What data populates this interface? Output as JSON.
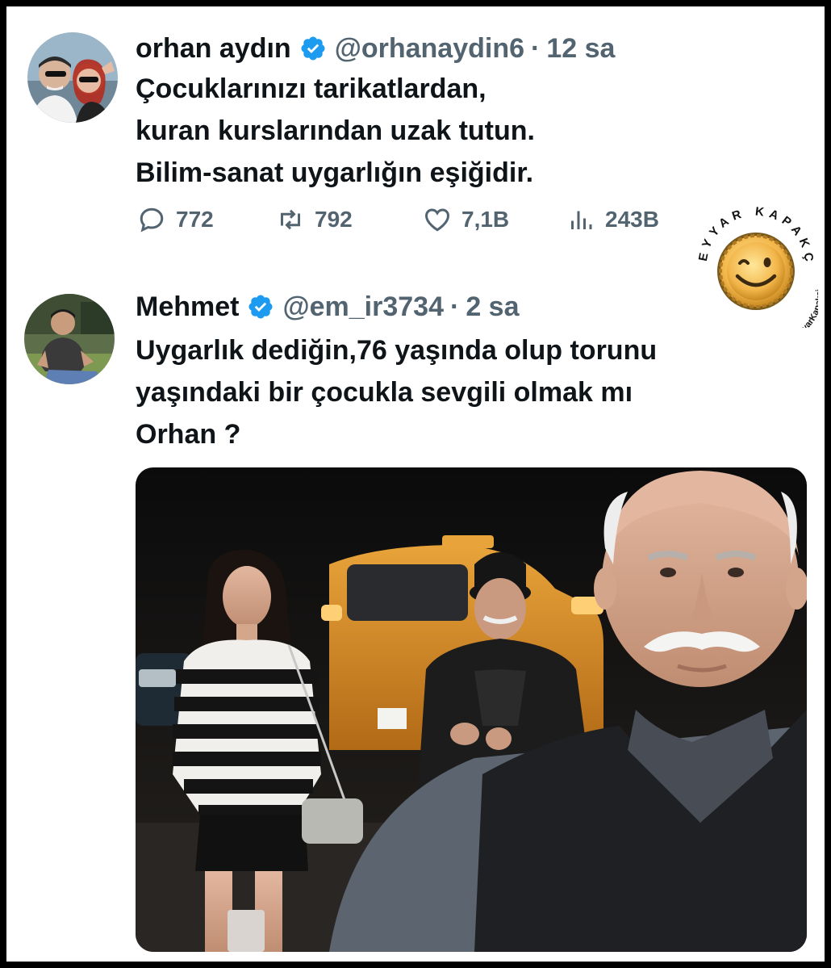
{
  "tweet1": {
    "name": "orhan aydın",
    "handle": "@orhanaydin6",
    "separator": "·",
    "time": "12 sa",
    "text": "Çocuklarınızı tarikatlardan,\nkuran kurslarından uzak tutun.\nBilim-sanat uygarlığın eşiğidir.",
    "stats": {
      "replies": "772",
      "retweets": "792",
      "likes": "7,1B",
      "views": "243B"
    }
  },
  "tweet2": {
    "name": "Mehmet",
    "handle": "@em_ir3734",
    "separator": "·",
    "time": "2 sa",
    "text": "Uygarlık dediğin,76 yaşında olup torunu\nyaşındaki bir çocukla sevgili olmak mı\nOrhan ?"
  },
  "watermark": {
    "top_text": "SEYYAR KAPAKÇI",
    "bottom_text": "twitter.com/SeyyarKapakci"
  },
  "colors": {
    "verified": "#1d9bf0",
    "secondary_text": "#536471",
    "primary_text": "#0f1419"
  },
  "icons": [
    "reply-icon",
    "retweet-icon",
    "like-icon",
    "views-icon",
    "verified-badge-icon"
  ]
}
